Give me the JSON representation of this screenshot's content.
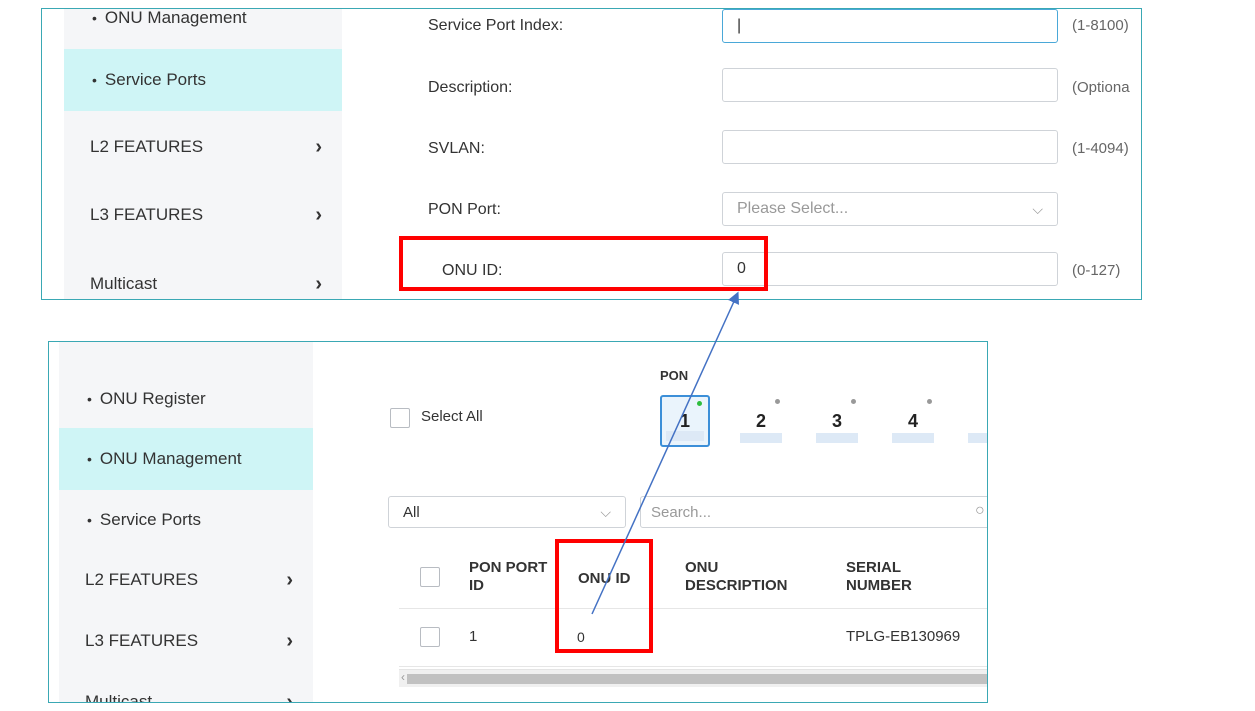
{
  "top": {
    "sidebar": {
      "items": [
        {
          "label": "ONU Management",
          "type": "sub"
        },
        {
          "label": "Service Ports",
          "type": "sub",
          "active": true
        },
        {
          "label": "L2 FEATURES",
          "type": "category"
        },
        {
          "label": "L3 FEATURES",
          "type": "category"
        },
        {
          "label": "Multicast",
          "type": "category"
        }
      ]
    },
    "form": {
      "service_port_index": {
        "label": "Service Port Index:",
        "value": "|",
        "hint": "(1-8100)"
      },
      "description": {
        "label": "Description:",
        "value": "",
        "hint": "(Optiona"
      },
      "svlan": {
        "label": "SVLAN:",
        "value": "",
        "hint": "(1-4094)"
      },
      "pon_port": {
        "label": "PON Port:",
        "placeholder": "Please Select..."
      },
      "onu_id": {
        "label": "ONU ID:",
        "value": "0",
        "hint": "(0-127)"
      }
    }
  },
  "bottom": {
    "sidebar": {
      "items": [
        {
          "label": "ONU Register",
          "type": "sub"
        },
        {
          "label": "ONU Management",
          "type": "sub",
          "active": true
        },
        {
          "label": "Service Ports",
          "type": "sub"
        },
        {
          "label": "L2 FEATURES",
          "type": "category"
        },
        {
          "label": "L3 FEATURES",
          "type": "category"
        },
        {
          "label": "Multicast",
          "type": "category"
        }
      ]
    },
    "select_all": "Select All",
    "pon": {
      "label": "PON",
      "ports": [
        "1",
        "2",
        "3",
        "4"
      ],
      "selected": "1"
    },
    "filter": {
      "value": "All",
      "search_placeholder": "Search..."
    },
    "table": {
      "headers": {
        "pon_port_id": [
          "PON PORT",
          "ID"
        ],
        "onu_id": "ONU ID",
        "onu_description": [
          "ONU",
          "DESCRIPTION"
        ],
        "serial_number": [
          "SERIAL",
          "NUMBER"
        ]
      },
      "rows": [
        {
          "pon_port_id": "1",
          "onu_id": "0",
          "onu_description": "",
          "serial_number": "TPLG-EB130969"
        }
      ]
    }
  },
  "colors": {
    "accent": "#3aa8b4",
    "highlight": "#ff0000",
    "arrow": "#4472c4",
    "active_bg": "#cff5f6"
  }
}
